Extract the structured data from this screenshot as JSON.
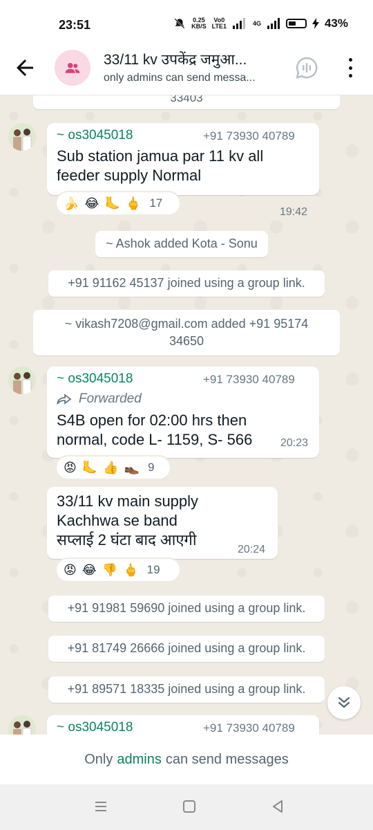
{
  "status_bar": {
    "time": "23:51",
    "net_speed_top": "0.25",
    "net_speed_bottom": "KB/S",
    "volte_top": "Vo0",
    "volte_bottom": "LTE1",
    "network": "4G",
    "battery_percent": "43%"
  },
  "header": {
    "title": "33/11 kv उपकेंद्र जमुआ...",
    "subtitle": "only admins can send messa..."
  },
  "chat": {
    "partial_top_text": "33403",
    "messages": [
      {
        "sender": "~ os3045018",
        "phone": "+91 73930 40789",
        "text_lines": [
          "Sub station jamua par 11 kv all",
          "feeder supply Normal"
        ],
        "time": "19:42",
        "reactions": [
          "🍌",
          "😂",
          "🦶",
          "🖕"
        ],
        "reaction_count": "17"
      },
      {
        "sender": "~ os3045018",
        "phone": "+91 73930 40789",
        "forwarded_label": "Forwarded",
        "text_lines": [
          "S4B open for 02:00 hrs then",
          "normal, code L- 1159, S- 566"
        ],
        "time": "20:23",
        "reactions": [
          "😡",
          "🦶",
          "👍",
          "👞"
        ],
        "reaction_count": "9"
      },
      {
        "text_lines": [
          "33/11 kv  main supply",
          "Kachhwa se band",
          "सप्लाई 2 घंटा बाद आएगी"
        ],
        "time": "20:24",
        "reactions": [
          "😡",
          "😂",
          "👎",
          "🖕"
        ],
        "reaction_count": "19"
      },
      {
        "sender": "~ os3045018",
        "phone": "+91 73930 40789"
      }
    ],
    "system": [
      "~ Ashok added Kota - Sonu",
      "+91 91162 45137 joined using a group link.",
      "~ vikash7208@gmail.com added +91 95174",
      "34650",
      "+91 91981 59690 joined using a group link.",
      "+91 81749 26666 joined using a group link.",
      "+91 89571 18335 joined using a group link."
    ]
  },
  "footer": {
    "prefix": "Only",
    "link": "admins",
    "suffix": "can send messages"
  },
  "colors": {
    "accent_green": "#06855e",
    "chat_bg": "#efeae2",
    "avatar_pink": "#f9d9e3"
  },
  "icons": [
    "back-arrow-icon",
    "group-icon",
    "voice-chat-icon",
    "more-vert-icon",
    "forward-icon",
    "double-chevron-down-icon",
    "nav-recents-icon",
    "nav-home-icon",
    "nav-back-icon"
  ]
}
